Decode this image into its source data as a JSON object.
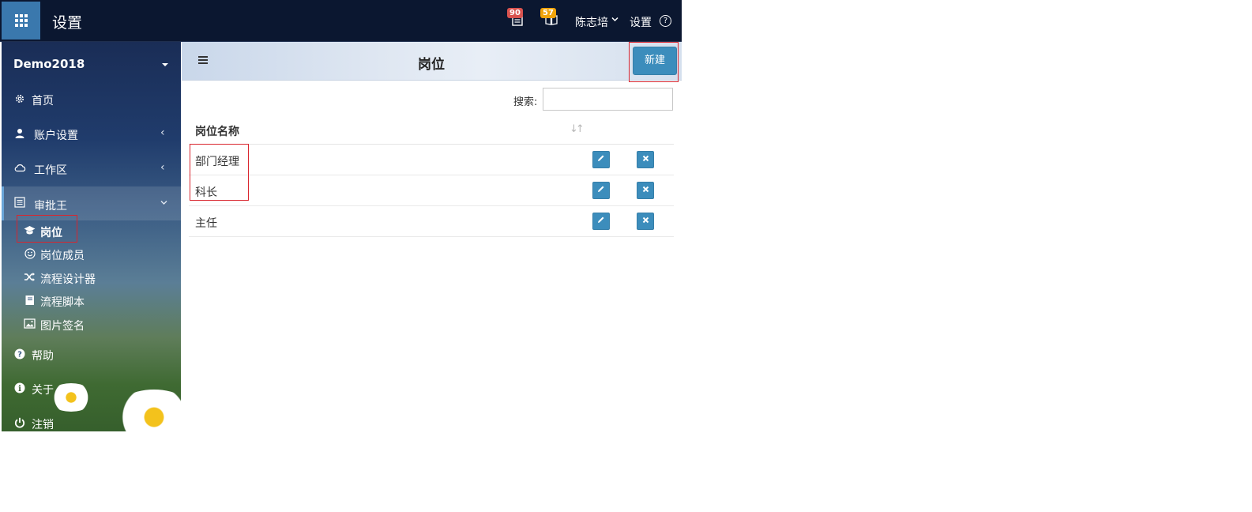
{
  "app": {
    "title": "设置"
  },
  "topbar": {
    "messages_badge": "90",
    "tasks_badge": "57",
    "user_name": "陈志培",
    "settings_label": "设置",
    "help_label": "?"
  },
  "sidebar": {
    "org_name": "Demo2018",
    "items": [
      {
        "label": "首页",
        "icon": "gear-icon"
      },
      {
        "label": "账户设置",
        "icon": "user-icon"
      },
      {
        "label": "工作区",
        "icon": "cloud-icon"
      },
      {
        "label": "审批王",
        "icon": "list-icon"
      }
    ],
    "sub_items": [
      {
        "label": "岗位",
        "icon": "graduation-cap-icon"
      },
      {
        "label": "岗位成员",
        "icon": "smile-icon"
      },
      {
        "label": "流程设计器",
        "icon": "shuffle-icon"
      },
      {
        "label": "流程脚本",
        "icon": "book-icon"
      },
      {
        "label": "图片签名",
        "icon": "image-icon"
      }
    ],
    "bottom_items": [
      {
        "label": "帮助",
        "icon": "question-circle-icon"
      },
      {
        "label": "关于",
        "icon": "info-circle-icon"
      },
      {
        "label": "注销",
        "icon": "power-icon"
      }
    ]
  },
  "main": {
    "title": "岗位",
    "new_button": "新建",
    "search_label": "搜索:",
    "search_value": "",
    "table": {
      "header": "岗位名称",
      "rows": [
        "部门经理",
        "科长",
        "主任"
      ]
    }
  },
  "colors": {
    "topbar": "#0b1730",
    "accent": "#3c8dbc",
    "highlight": "#d9252e"
  }
}
